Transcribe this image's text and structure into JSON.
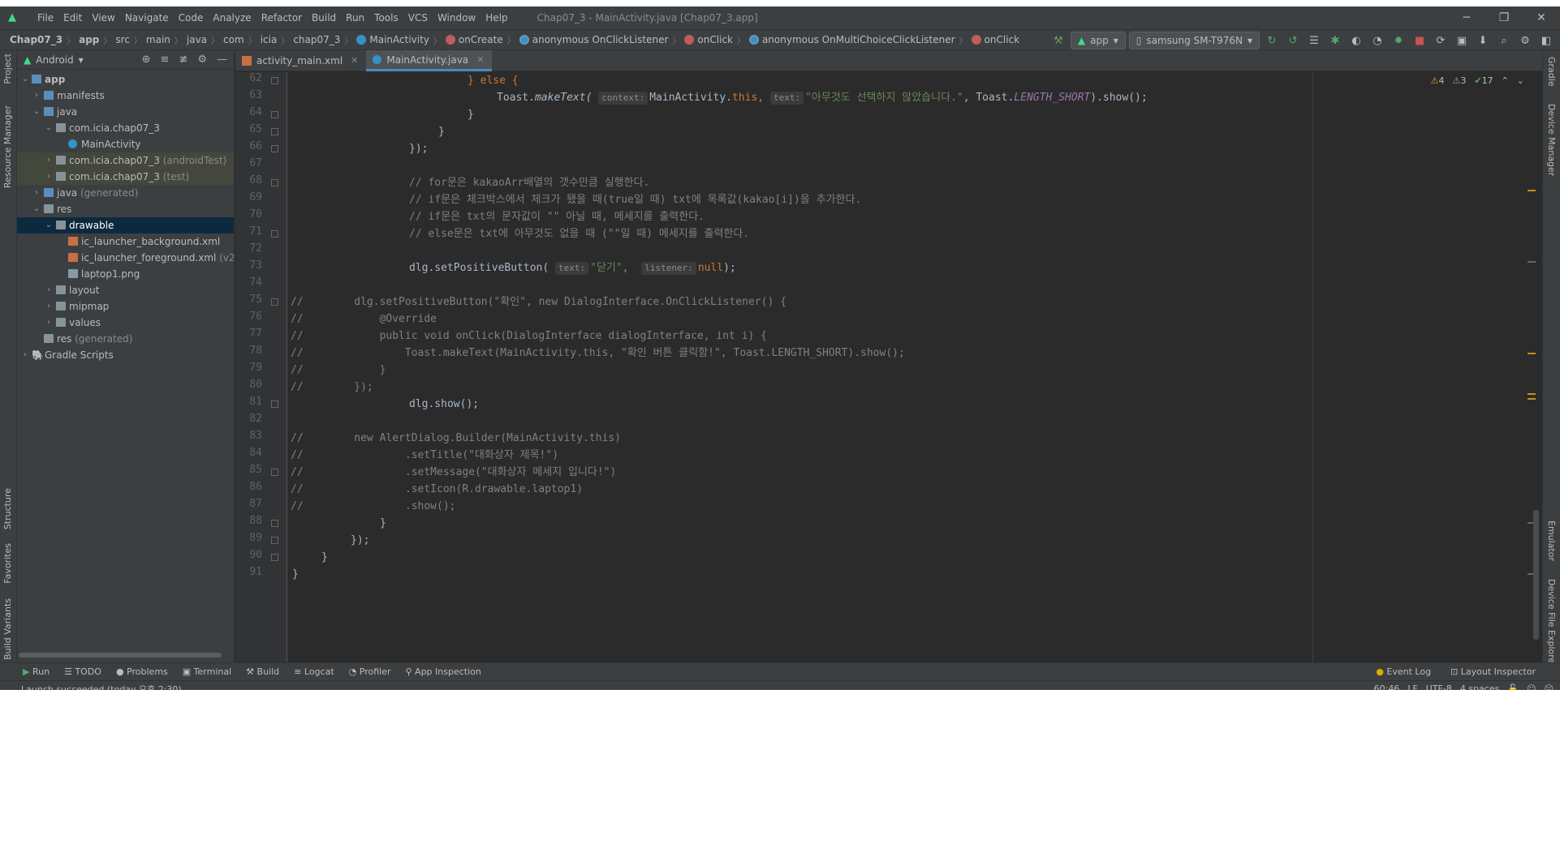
{
  "window": {
    "title": "Chap07_3 - MainActivity.java [Chap07_3.app]",
    "menu": [
      "File",
      "Edit",
      "View",
      "Navigate",
      "Code",
      "Analyze",
      "Refactor",
      "Build",
      "Run",
      "Tools",
      "VCS",
      "Window",
      "Help"
    ],
    "controls": [
      "─",
      "❐",
      "✕"
    ]
  },
  "breadcrumb": {
    "items": [
      {
        "label": "Chap07_3"
      },
      {
        "label": "app"
      },
      {
        "label": "src"
      },
      {
        "label": "main"
      },
      {
        "label": "java"
      },
      {
        "label": "com"
      },
      {
        "label": "icia"
      },
      {
        "label": "chap07_3"
      },
      {
        "label": "MainActivity"
      },
      {
        "label": "onCreate"
      },
      {
        "label": "anonymous OnClickListener"
      },
      {
        "label": "onClick"
      },
      {
        "label": "anonymous OnMultiChoiceClickListener"
      },
      {
        "label": "onClick"
      }
    ],
    "run_config": "app",
    "device": "samsung SM-T976N"
  },
  "project_panel": {
    "view": "Android",
    "tree": [
      {
        "label": "app",
        "suffix": ""
      },
      {
        "label": "manifests",
        "suffix": ""
      },
      {
        "label": "java",
        "suffix": ""
      },
      {
        "label": "com.icia.chap07_3",
        "suffix": ""
      },
      {
        "label": "MainActivity",
        "suffix": ""
      },
      {
        "label": "com.icia.chap07_3",
        "suffix": " (androidTest)"
      },
      {
        "label": "com.icia.chap07_3",
        "suffix": " (test)"
      },
      {
        "label": "java",
        "suffix": " (generated)"
      },
      {
        "label": "res",
        "suffix": ""
      },
      {
        "label": "drawable",
        "suffix": ""
      },
      {
        "label": "ic_launcher_background.xml",
        "suffix": ""
      },
      {
        "label": "ic_launcher_foreground.xml",
        "suffix": " (v2"
      },
      {
        "label": "laptop1.png",
        "suffix": ""
      },
      {
        "label": "layout",
        "suffix": ""
      },
      {
        "label": "mipmap",
        "suffix": ""
      },
      {
        "label": "values",
        "suffix": ""
      },
      {
        "label": "res",
        "suffix": " (generated)"
      },
      {
        "label": "Gradle Scripts",
        "suffix": ""
      }
    ]
  },
  "side_tabs": {
    "left": [
      "Project",
      "Resource Manager",
      "Structure",
      "Favorites",
      "Build Variants"
    ],
    "right": [
      "Gradle",
      "Device Manager",
      "Emulator",
      "Device File Explorer"
    ]
  },
  "editor": {
    "tabs": [
      {
        "label": "activity_main.xml",
        "active": false
      },
      {
        "label": "MainActivity.java",
        "active": true
      }
    ],
    "inspections": {
      "warnings": "4",
      "weak": "3",
      "ok": "17"
    },
    "lines": [
      {
        "n": "62"
      },
      {
        "n": "63"
      },
      {
        "n": "64"
      },
      {
        "n": "65"
      },
      {
        "n": "66"
      },
      {
        "n": "67"
      },
      {
        "n": "68"
      },
      {
        "n": "69"
      },
      {
        "n": "70"
      },
      {
        "n": "71"
      },
      {
        "n": "72"
      },
      {
        "n": "73"
      },
      {
        "n": "74"
      },
      {
        "n": "75"
      },
      {
        "n": "76"
      },
      {
        "n": "77"
      },
      {
        "n": "78"
      },
      {
        "n": "79"
      },
      {
        "n": "80"
      },
      {
        "n": "81"
      },
      {
        "n": "82"
      },
      {
        "n": "83"
      },
      {
        "n": "84"
      },
      {
        "n": "85"
      },
      {
        "n": "86"
      },
      {
        "n": "87"
      },
      {
        "n": "88"
      },
      {
        "n": "89"
      },
      {
        "n": "90"
      },
      {
        "n": "91"
      }
    ],
    "code": {
      "l62": "} else {",
      "l63_a": "Toast.",
      "l63_b": "makeText(",
      "l63_hint1": "context:",
      "l63_c": "MainActivity.",
      "l63_d": "this",
      "l63_e": ",",
      "l63_hint2": "text:",
      "l63_str": "\"아무것도 선택하지 않았습니다.\"",
      "l63_f": ", Toast.",
      "l63_fld": "LENGTH_SHORT",
      "l63_g": ").show();",
      "l64": "}",
      "l65": "}",
      "l66": "});",
      "l68": "// for문은 kakaoArr배열의 갯수만큼 실행한다.",
      "l69": "// if문은 체크박스에서 체크가 됐을 때(true일 때) txt에 목록값(kakao[i])을 추가한다.",
      "l70": "// if문은 txt의 문자값이 \"\" 아닐 때, 메세지를 출력한다.",
      "l71": "// else문은 txt에 아무것도 없을 때 (\"\"일 때) 메세지를 출력한다.",
      "l73_a": "dlg.setPositiveButton(",
      "l73_hint1": "text:",
      "l73_str": "\"닫기\"",
      "l73_b": ",",
      "l73_hint2": "listener:",
      "l73_null": "null",
      "l73_c": ");",
      "l75": "//        dlg.setPositiveButton(\"확인\", new DialogInterface.OnClickListener() {",
      "l76": "//            @Override",
      "l77": "//            public void onClick(DialogInterface dialogInterface, int i) {",
      "l78": "//                Toast.makeText(MainActivity.this, \"확인 버튼 클릭함!\", Toast.LENGTH_SHORT).show();",
      "l79": "//            }",
      "l80": "//        });",
      "l81": "dlg.show();",
      "l83": "//        new AlertDialog.Builder(MainActivity.this)",
      "l84": "//                .setTitle(\"대화상자 제목!\")",
      "l85": "//                .setMessage(\"대화상자 메세지 입니다!\")",
      "l86": "//                .setIcon(R.drawable.laptop1)",
      "l87": "//                .show();",
      "l88": "}",
      "l89": "});",
      "l90": "}",
      "l91": "}"
    }
  },
  "bottom_tools": {
    "left": [
      "Run",
      "TODO",
      "Problems",
      "Terminal",
      "Build",
      "Logcat",
      "Profiler",
      "App Inspection"
    ],
    "right": [
      "Event Log",
      "Layout Inspector"
    ]
  },
  "status": {
    "message": "Launch succeeded (today 오후 2:30)",
    "position": "60:46",
    "line_sep": "LF",
    "encoding": "UTF-8",
    "indent": "4 spaces"
  },
  "colors": {
    "background": "#2b2b2b",
    "panel": "#3c3f41",
    "keyword": "#cc7832",
    "string": "#6a8759",
    "comment": "#808080",
    "field": "#9876aa",
    "selection": "#0d293e"
  }
}
